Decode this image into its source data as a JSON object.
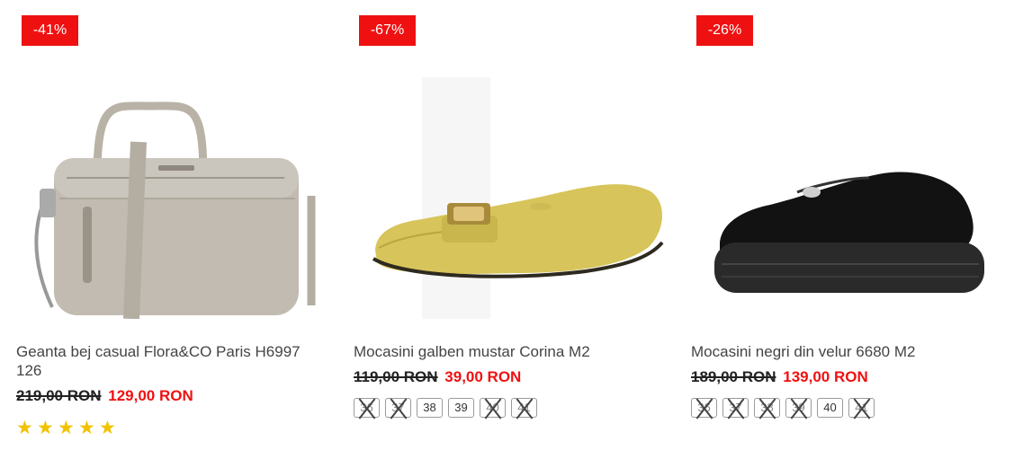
{
  "products": [
    {
      "discount": "-41%",
      "title": "Geanta bej casual Flora&CO Paris H6997 126",
      "old_price": "219,00 RON",
      "new_price": "129,00 RON",
      "rating": 5,
      "stars": [
        "★",
        "★",
        "★",
        "★",
        "★"
      ]
    },
    {
      "discount": "-67%",
      "title": "Mocasini galben mustar Corina M2",
      "old_price": "119,00 RON",
      "new_price": "39,00 RON",
      "sizes": [
        {
          "label": "36",
          "available": false
        },
        {
          "label": "37",
          "available": false
        },
        {
          "label": "38",
          "available": true
        },
        {
          "label": "39",
          "available": true
        },
        {
          "label": "40",
          "available": false
        },
        {
          "label": "41",
          "available": false
        }
      ]
    },
    {
      "discount": "-26%",
      "title": "Mocasini negri din velur 6680 M2",
      "old_price": "189,00 RON",
      "new_price": "139,00 RON",
      "sizes": [
        {
          "label": "36",
          "available": false
        },
        {
          "label": "37",
          "available": false
        },
        {
          "label": "38",
          "available": false
        },
        {
          "label": "39",
          "available": false
        },
        {
          "label": "40",
          "available": true
        },
        {
          "label": "41",
          "available": false
        }
      ]
    }
  ],
  "colors": {
    "badge": "#ef1111",
    "new_price": "#ef1111",
    "star": "#f2c200"
  }
}
